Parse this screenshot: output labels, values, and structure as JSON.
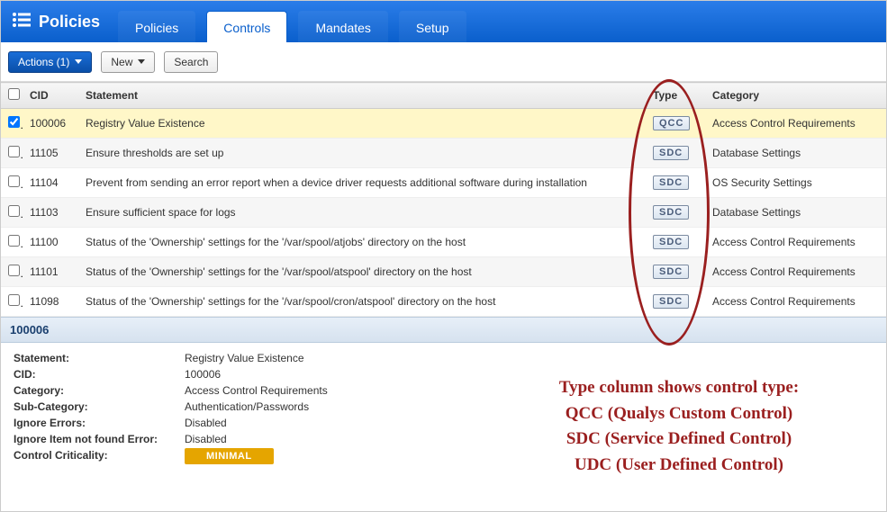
{
  "header": {
    "title": "Policies",
    "tabs": [
      {
        "label": "Policies",
        "active": false
      },
      {
        "label": "Controls",
        "active": true
      },
      {
        "label": "Mandates",
        "active": false
      },
      {
        "label": "Setup",
        "active": false
      }
    ]
  },
  "toolbar": {
    "actions_label": "Actions (1)",
    "new_label": "New",
    "search_label": "Search"
  },
  "table": {
    "headers": {
      "cid": "CID",
      "statement": "Statement",
      "type": "Type",
      "category": "Category"
    },
    "rows": [
      {
        "selected": true,
        "checked": true,
        "cid": "100006",
        "statement": "Registry Value Existence",
        "type": "QCC",
        "category": "Access Control Requirements"
      },
      {
        "selected": false,
        "checked": false,
        "cid": "11105",
        "statement": "Ensure thresholds are set up",
        "type": "SDC",
        "category": "Database Settings"
      },
      {
        "selected": false,
        "checked": false,
        "cid": "11104",
        "statement": "Prevent from sending an error report when a device driver requests additional software during installation",
        "type": "SDC",
        "category": "OS Security Settings"
      },
      {
        "selected": false,
        "checked": false,
        "cid": "11103",
        "statement": "Ensure sufficient space for logs",
        "type": "SDC",
        "category": "Database Settings"
      },
      {
        "selected": false,
        "checked": false,
        "cid": "11100",
        "statement": "Status of the 'Ownership' settings for the '/var/spool/atjobs' directory on the host",
        "type": "SDC",
        "category": "Access Control Requirements"
      },
      {
        "selected": false,
        "checked": false,
        "cid": "11101",
        "statement": "Status of the 'Ownership' settings for the '/var/spool/atspool' directory on the host",
        "type": "SDC",
        "category": "Access Control Requirements"
      },
      {
        "selected": false,
        "checked": false,
        "cid": "11098",
        "statement": "Status of the 'Ownership' settings for the '/var/spool/cron/atspool' directory on the host",
        "type": "SDC",
        "category": "Access Control Requirements"
      }
    ]
  },
  "detail": {
    "id": "100006",
    "rows": [
      {
        "label": "Statement:",
        "value": "Registry Value Existence"
      },
      {
        "label": "CID:",
        "value": "100006"
      },
      {
        "label": "Category:",
        "value": "Access Control Requirements"
      },
      {
        "label": "Sub-Category:",
        "value": "Authentication/Passwords"
      },
      {
        "label": "Ignore Errors:",
        "value": "Disabled"
      },
      {
        "label": "Ignore Item not found Error:",
        "value": "Disabled"
      }
    ],
    "criticality_label": "Control Criticality:",
    "criticality_value": "MINIMAL"
  },
  "callout": {
    "line1": "Type column shows control type:",
    "line2": "QCC (Qualys Custom Control)",
    "line3": "SDC (Service Defined Control)",
    "line4": "UDC (User Defined Control)"
  }
}
